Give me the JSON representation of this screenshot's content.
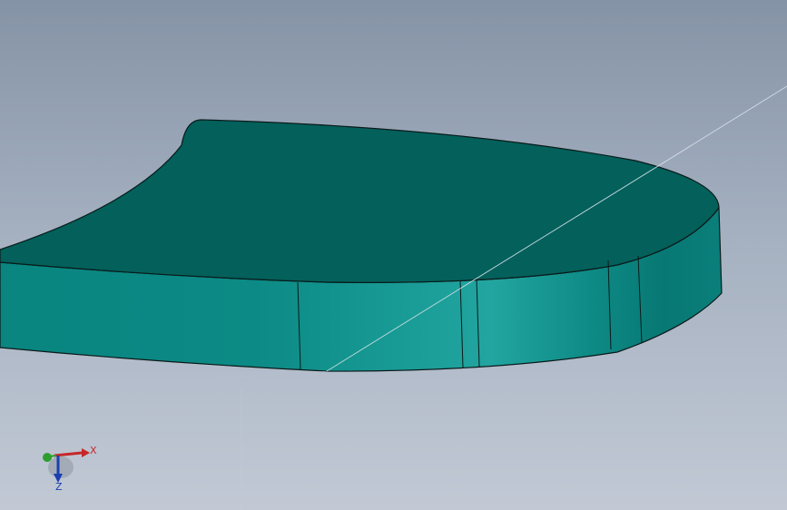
{
  "viewport": {
    "background_top": "#8593a6",
    "background_bottom": "#c2c9d5"
  },
  "model": {
    "top_face_color": "#03605b",
    "side_face_color": "#0e8f8a",
    "side_highlight_color": "#1fa39e",
    "edge_color": "#0a1a1a"
  },
  "triad": {
    "x_label": "X",
    "z_label": "Z",
    "x_color": "#c62828",
    "y_color": "#2e9e2e",
    "z_color": "#1a3fb0"
  }
}
